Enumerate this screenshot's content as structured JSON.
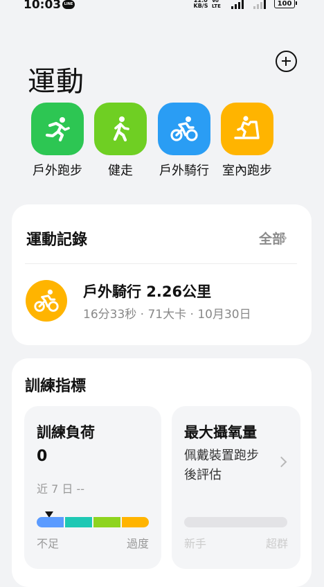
{
  "status_bar": {
    "time": "10:03",
    "line_icon": "LINE",
    "net_speed": "22.0\nKB/S",
    "volte": "VoLTE",
    "battery": "100"
  },
  "header": {
    "title": "運動",
    "add_icon": "plus-circle-icon"
  },
  "quick_start": [
    {
      "label": "戶外跑步",
      "icon": "running-icon",
      "color": "#2dc653"
    },
    {
      "label": "健走",
      "icon": "walking-icon",
      "color": "#6fcf23"
    },
    {
      "label": "戶外騎行",
      "icon": "cycling-icon",
      "color": "#2a9df4"
    },
    {
      "label": "室內跑步",
      "icon": "treadmill-icon",
      "color": "#ffb400"
    }
  ],
  "records": {
    "title": "運動記錄",
    "all_label": "全部",
    "latest": {
      "icon": "cycling-icon",
      "title": "戶外騎行 2.26公里",
      "subtitle": "16分33秒 · 71大卡 · 10月30日"
    }
  },
  "training": {
    "title": "訓練指標",
    "load": {
      "title": "訓練負荷",
      "value": "0",
      "period": "近 7 日 --",
      "scale_low": "不足",
      "scale_high": "過度",
      "bar_colors": [
        "#5b9bff",
        "#1ec8b4",
        "#8ed41f",
        "#ffb400"
      ]
    },
    "vo2max": {
      "title": "最大攝氧量",
      "description": "佩戴裝置跑步後評估",
      "scale_low": "新手",
      "scale_high": "超群"
    }
  }
}
